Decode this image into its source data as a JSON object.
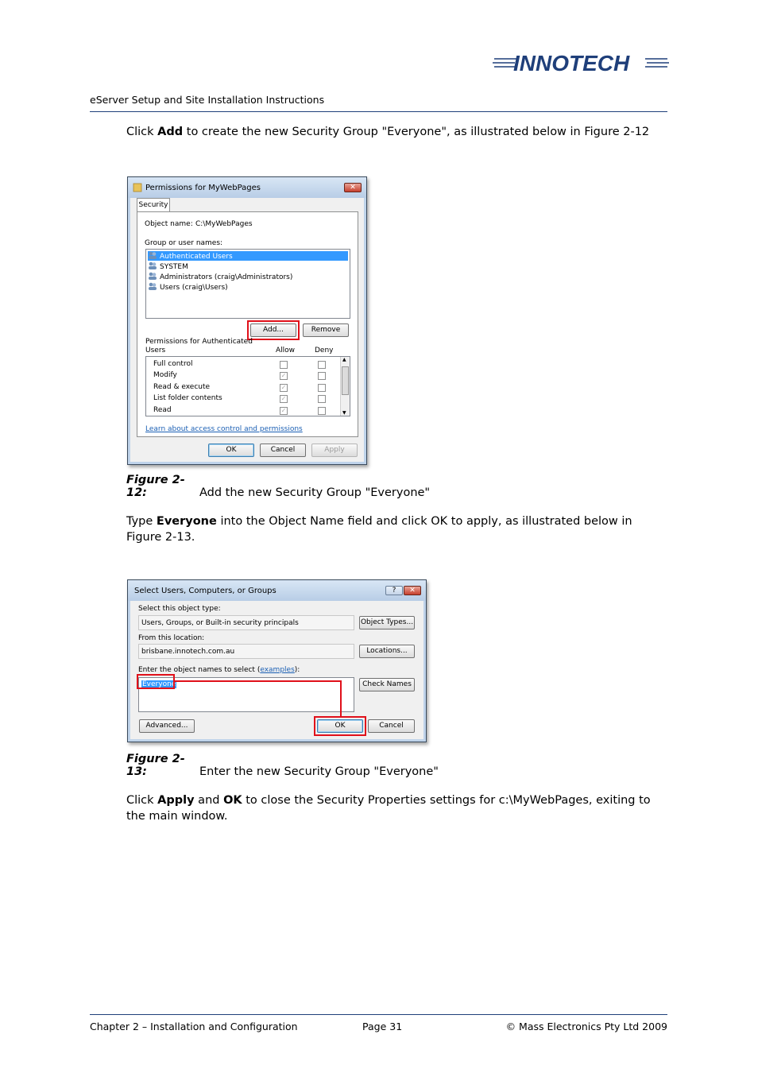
{
  "header": {
    "logo_text": "INNOTECH",
    "doc_title": "eServer Setup and Site Installation Instructions"
  },
  "para1": {
    "pre": "Click ",
    "bold": "Add",
    "post": " to create the new Security Group \"Everyone\", as illustrated below in Figure 2-12"
  },
  "dialog1": {
    "title": "Permissions for MyWebPages",
    "tab": "Security",
    "object_name_label": "Object name:",
    "object_name_value": "C:\\MyWebPages",
    "group_label": "Group or user names:",
    "users": [
      "Authenticated Users",
      "SYSTEM",
      "Administrators (craig\\Administrators)",
      "Users (craig\\Users)"
    ],
    "add_button": "Add...",
    "remove_button": "Remove",
    "perm_label_1": "Permissions for Authenticated",
    "perm_label_2": "Users",
    "allow_header": "Allow",
    "deny_header": "Deny",
    "permissions": [
      "Full control",
      "Modify",
      "Read & execute",
      "List folder contents",
      "Read"
    ],
    "learn_link": "Learn about access control and permissions",
    "ok": "OK",
    "cancel": "Cancel",
    "apply": "Apply"
  },
  "caption1": {
    "label": "Figure 2-12:",
    "text": "Add the new Security Group \"Everyone\""
  },
  "para2": {
    "pre": "Type ",
    "bold": "Everyone",
    "post": " into the Object Name field and click OK to apply, as illustrated below in Figure 2-13."
  },
  "dialog2": {
    "title": "Select Users, Computers, or Groups",
    "help": "?",
    "obj_type_label": "Select this object type:",
    "obj_type_value": "Users, Groups, or Built-in security principals",
    "object_types_button": "Object Types...",
    "location_label": "From this location:",
    "location_value": "brisbane.innotech.com.au",
    "locations_button": "Locations...",
    "enter_label": "Enter the object names to select (",
    "examples_link": "examples",
    "enter_label_end": "):",
    "entered_value": "Everyone",
    "check_names_button": "Check Names",
    "advanced_button": "Advanced...",
    "ok": "OK",
    "cancel": "Cancel"
  },
  "caption2": {
    "label": "Figure 2-13:",
    "text": "Enter the new Security Group \"Everyone\""
  },
  "para3": {
    "t1": "Click ",
    "b1": "Apply",
    "t2": " and ",
    "b2": "OK",
    "t3": " to close  the Security Properties settings for c:\\MyWebPages, exiting to the main window."
  },
  "footer": {
    "left": "Chapter 2 – Installation and Configuration",
    "center": "Page 31",
    "right": "©  Mass Electronics Pty Ltd  2009"
  },
  "colors": {
    "brand": "#1f3f7a",
    "highlight": "#e0101a",
    "selection": "#3399ff"
  }
}
